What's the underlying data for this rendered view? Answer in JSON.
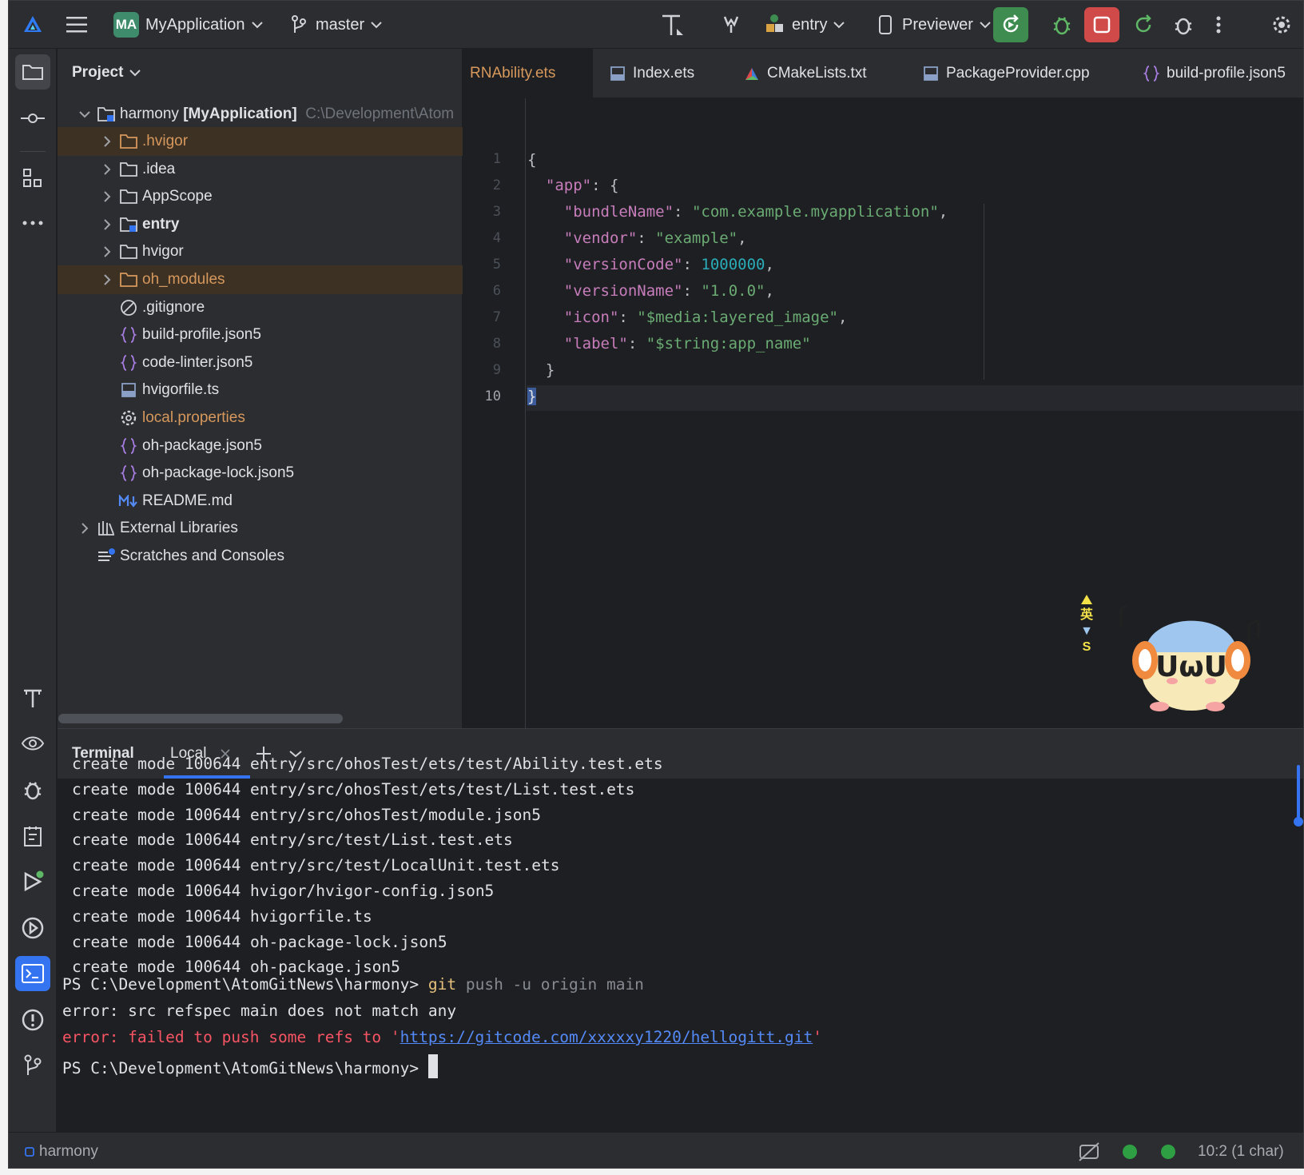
{
  "toolbar": {
    "project_badge": "MA",
    "project_name": "MyApplication",
    "branch": "master",
    "run_config": "entry",
    "device": "Previewer"
  },
  "colors": {
    "background": "#1e1f22",
    "panel": "#2b2d30",
    "accent": "#3574f0",
    "run_green": "#3e8c4f",
    "stop_red": "#d04a4a",
    "ignored_orange": "#d6985c",
    "error_red": "#f75464"
  },
  "activity_bar": {
    "top_icons": [
      "folder-icon",
      "commit-icon",
      "structure-icon",
      "more-icon"
    ],
    "bottom_icons": [
      "build-icon",
      "profiler-icon",
      "debug-icon",
      "todo-icon",
      "run-icon",
      "services-icon",
      "terminal-icon",
      "problems-icon",
      "git-icon"
    ]
  },
  "project": {
    "header": "Project",
    "root": {
      "name": "harmony",
      "module": "[MyApplication]",
      "path": "C:\\Development\\Atom"
    },
    "items": [
      {
        "label": ".hvigor",
        "icon": "folder",
        "expandable": true,
        "ignored": true
      },
      {
        "label": ".idea",
        "icon": "folder",
        "expandable": true,
        "ignored": false
      },
      {
        "label": "AppScope",
        "icon": "folder",
        "expandable": true,
        "ignored": false
      },
      {
        "label": "entry",
        "icon": "module-folder",
        "expandable": true,
        "ignored": false
      },
      {
        "label": "hvigor",
        "icon": "folder",
        "expandable": true,
        "ignored": false
      },
      {
        "label": "oh_modules",
        "icon": "folder",
        "expandable": true,
        "ignored": true
      },
      {
        "label": ".gitignore",
        "icon": "ignore-file",
        "expandable": false,
        "ignored": false
      },
      {
        "label": "build-profile.json5",
        "icon": "json",
        "expandable": false,
        "ignored": false
      },
      {
        "label": "code-linter.json5",
        "icon": "json",
        "expandable": false,
        "ignored": false
      },
      {
        "label": "hvigorfile.ts",
        "icon": "ts",
        "expandable": false,
        "ignored": false
      },
      {
        "label": "local.properties",
        "icon": "settings",
        "expandable": false,
        "ignored": true
      },
      {
        "label": "oh-package.json5",
        "icon": "json",
        "expandable": false,
        "ignored": false
      },
      {
        "label": "oh-package-lock.json5",
        "icon": "json",
        "expandable": false,
        "ignored": false
      },
      {
        "label": "README.md",
        "icon": "markdown",
        "expandable": false,
        "ignored": false
      }
    ],
    "external_libraries": "External Libraries",
    "scratches": "Scratches and Consoles"
  },
  "editor": {
    "tabs": [
      {
        "label": "RNAbility.ets",
        "active": true
      },
      {
        "label": "Index.ets",
        "active": false
      },
      {
        "label": "CMakeLists.txt",
        "active": false
      },
      {
        "label": "PackageProvider.cpp",
        "active": false
      },
      {
        "label": "build-profile.json5",
        "active": false
      }
    ],
    "line_numbers": [
      "1",
      "2",
      "3",
      "4",
      "5",
      "6",
      "7",
      "8",
      "9",
      "10"
    ],
    "current_line": "10",
    "code": {
      "l1": "{",
      "l2_key": "\"app\"",
      "l2_rest": ": {",
      "l3_key": "\"bundleName\"",
      "l3_val": "\"com.example.myapplication\"",
      "l4_key": "\"vendor\"",
      "l4_val": "\"example\"",
      "l5_key": "\"versionCode\"",
      "l5_val": "1000000",
      "l6_key": "\"versionName\"",
      "l6_val": "\"1.0.0\"",
      "l7_key": "\"icon\"",
      "l7_val": "\"$media:layered_image\"",
      "l8_key": "\"label\"",
      "l8_val": "\"$string:app_name\"",
      "l9": "}",
      "l10": "}"
    }
  },
  "terminal": {
    "title": "Terminal",
    "tab": "Local",
    "lines": [
      "create mode 100644 entry/src/ohosTest/ets/test/Ability.test.ets",
      "create mode 100644 entry/src/ohosTest/ets/test/List.test.ets",
      "create mode 100644 entry/src/ohosTest/module.json5",
      "create mode 100644 entry/src/test/List.test.ets",
      "create mode 100644 entry/src/test/LocalUnit.test.ets",
      "create mode 100644 hvigor/hvigor-config.json5",
      "create mode 100644 hvigorfile.ts",
      "create mode 100644 oh-package-lock.json5",
      "create mode 100644 oh-package.json5"
    ],
    "prompt": "PS C:\\Development\\AtomGitNews\\harmony> ",
    "cmd_git": "git",
    "cmd_args": "push -u origin main",
    "error1": "error: src refspec main does not match any",
    "error2_prefix": "error: failed to push some refs to '",
    "error2_url": "https://gitcode.com/xxxxxy1220/hellogitt.git",
    "error2_suffix": "'"
  },
  "mascot": {
    "text": "UωU",
    "side_chars": "英"
  },
  "statusbar": {
    "project": "harmony",
    "position": "10:2 (1 char)"
  }
}
